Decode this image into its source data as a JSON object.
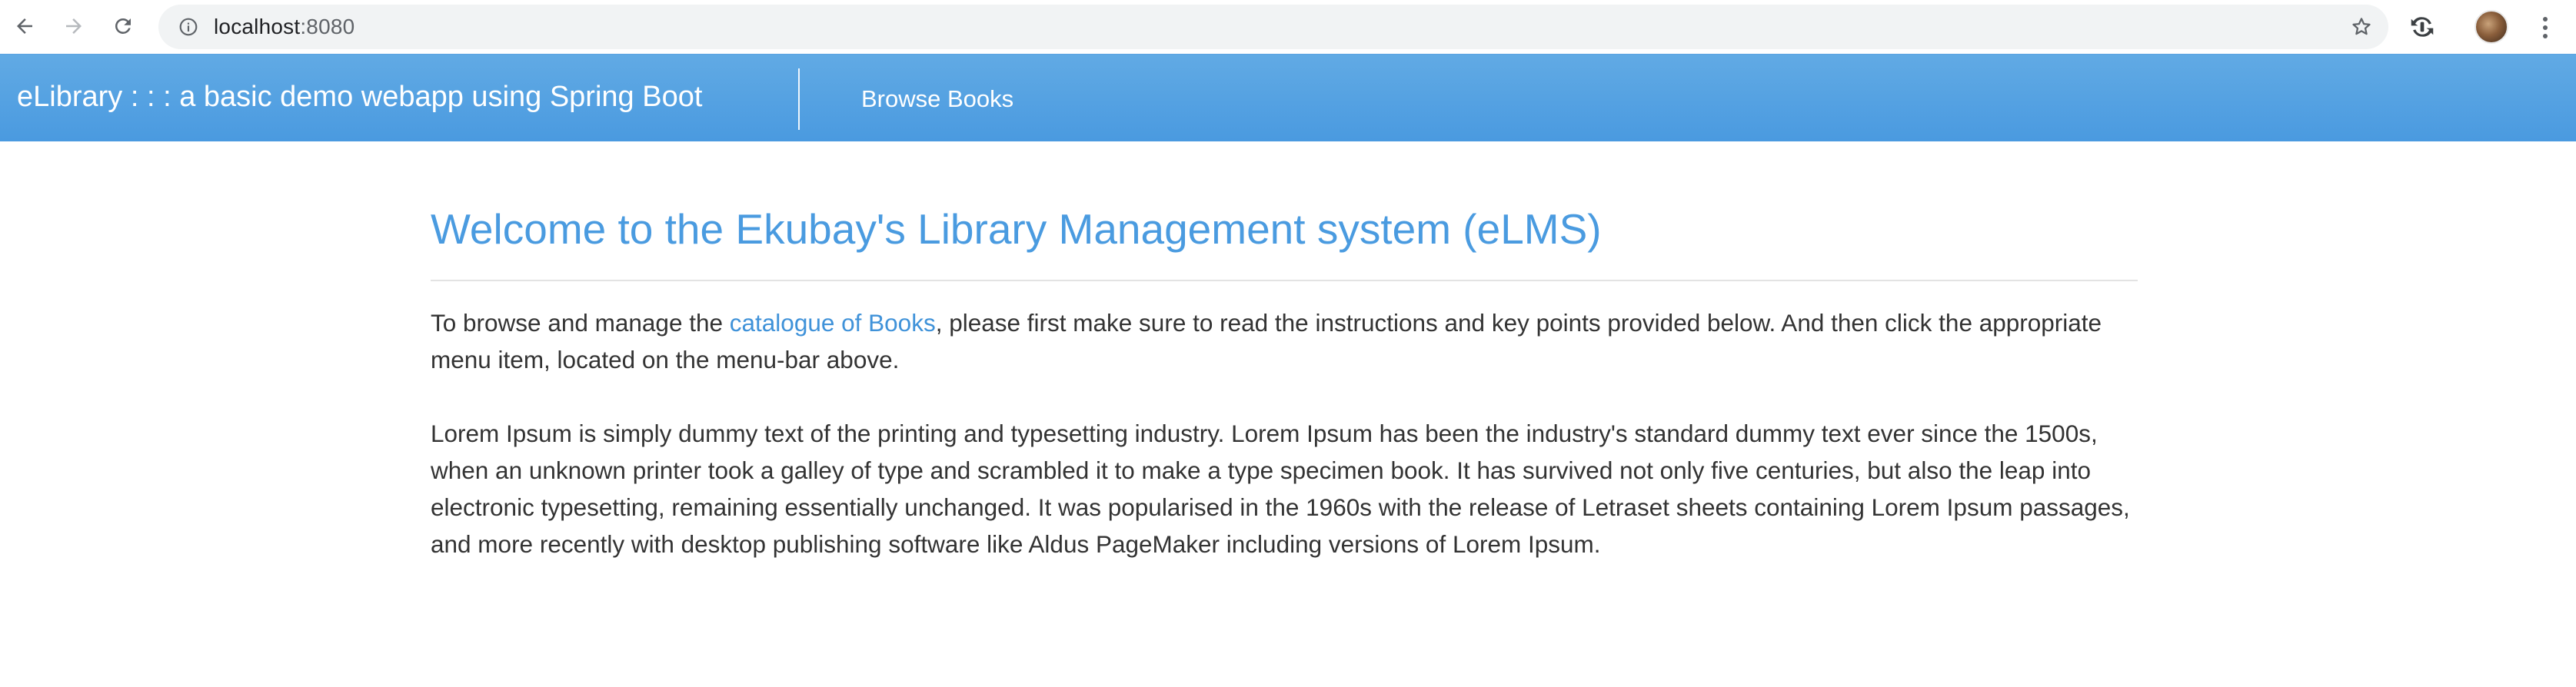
{
  "browser": {
    "url_host": "localhost",
    "url_port": ":8080"
  },
  "navbar": {
    "brand": "eLibrary : : : a basic demo webapp using Spring Boot",
    "browse_books": "Browse Books"
  },
  "main": {
    "title": "Welcome to the Ekubay's Library Management system (eLMS)",
    "intro_prefix": "To browse and manage the ",
    "intro_link": "catalogue of Books",
    "intro_suffix": ", please first make sure to read the instructions and key points provided below. And then click the appropriate menu item, located on the menu-bar above.",
    "lorem": "Lorem Ipsum is simply dummy text of the printing and typesetting industry. Lorem Ipsum has been the industry's standard dummy text ever since the 1500s, when an unknown printer took a galley of type and scrambled it to make a type specimen book. It has survived not only five centuries, but also the leap into electronic typesetting, remaining essentially unchanged. It was popularised in the 1960s with the release of Letraset sheets containing Lorem Ipsum passages, and more recently with desktop publishing software like Aldus PageMaker including versions of Lorem Ipsum."
  },
  "colors": {
    "navbar_top": "#61aae4",
    "navbar_bottom": "#4a9ae0",
    "title": "#4a9be0",
    "link": "#3f92d9",
    "body_text": "#333333"
  },
  "icons": [
    "back-arrow-icon",
    "forward-arrow-icon",
    "reload-icon",
    "info-icon",
    "bookmark-star-icon",
    "extension-sync-icon",
    "profile-avatar",
    "kebab-menu-icon"
  ]
}
